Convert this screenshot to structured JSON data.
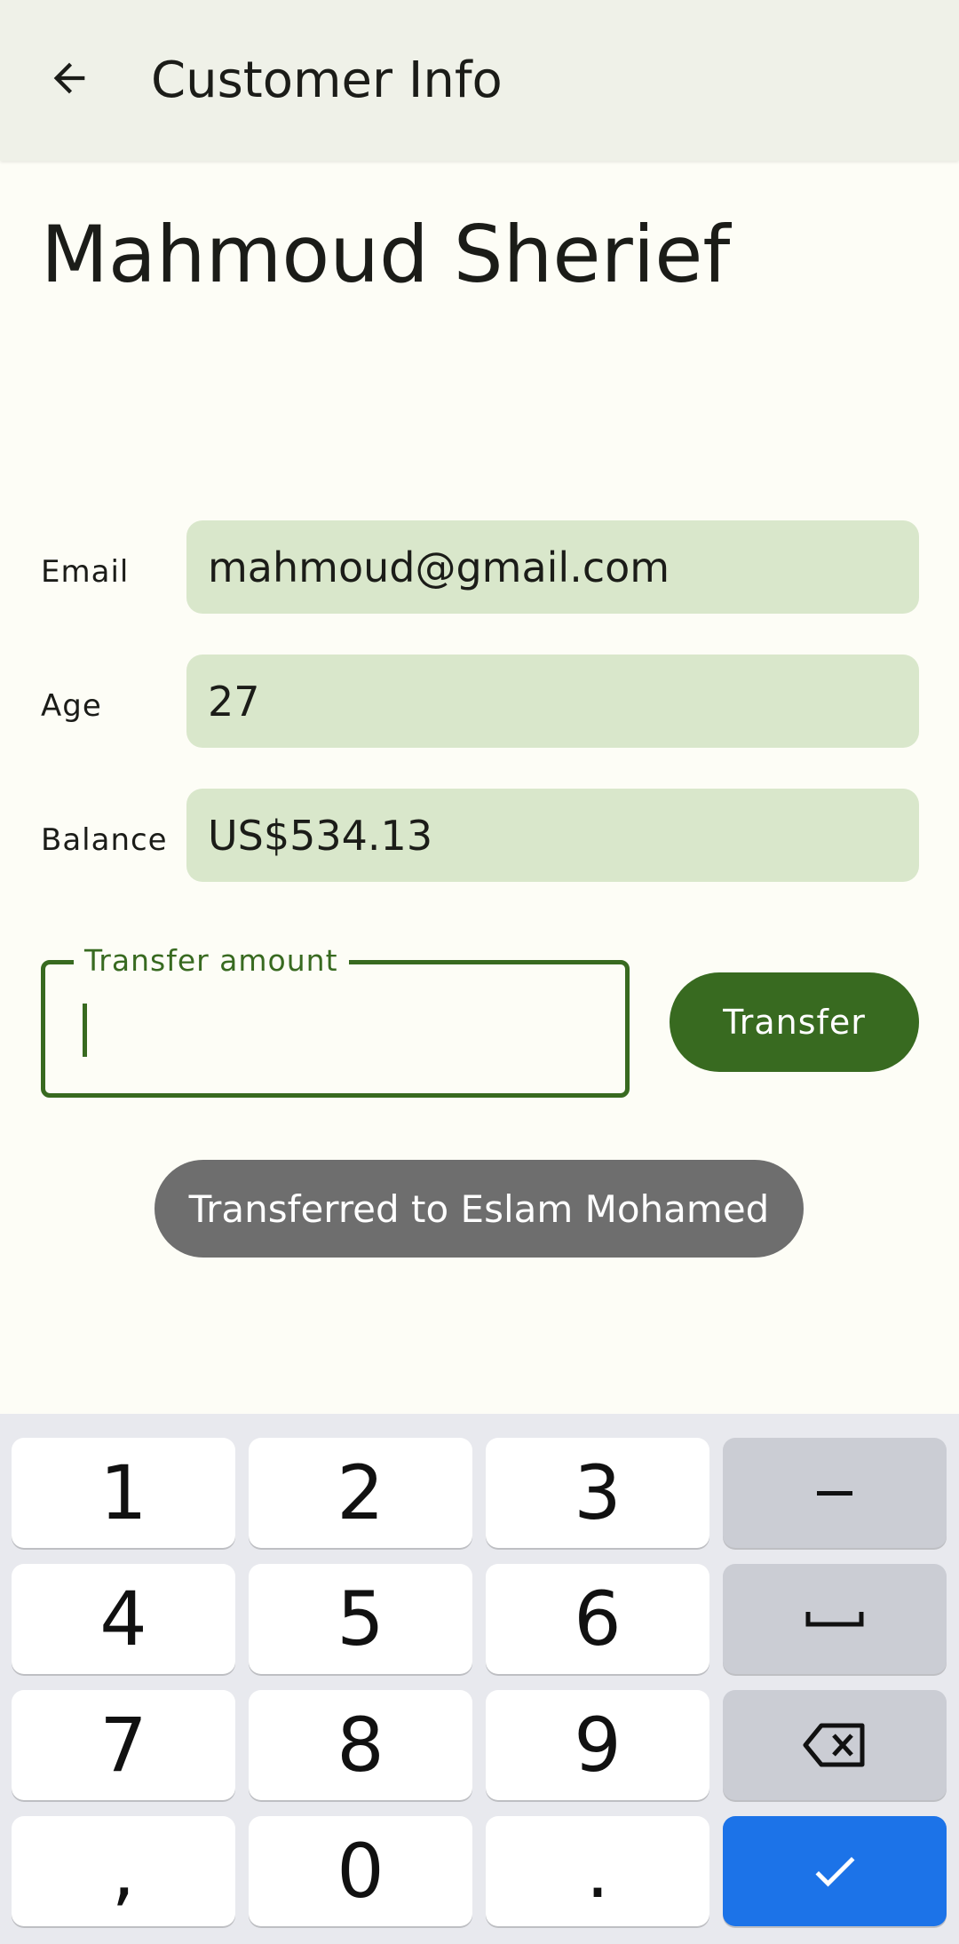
{
  "appbar": {
    "title": "Customer Info",
    "back_icon": "arrow-back-icon"
  },
  "customer": {
    "name": "Mahmoud Sherief"
  },
  "info": {
    "email_label": "Email",
    "email_value": "mahmoud@gmail.com",
    "age_label": "Age",
    "age_value": "27",
    "balance_label": "Balance",
    "balance_value": "US$534.13"
  },
  "transfer": {
    "amount_label": "Transfer amount",
    "amount_value": "",
    "button_label": "Transfer"
  },
  "toast": {
    "message": "Transferred to Eslam Mohamed"
  },
  "keyboard": {
    "keys": [
      "1",
      "2",
      "3",
      "−",
      "4",
      "5",
      "6",
      "␣",
      "7",
      "8",
      "9",
      "⌫",
      ",",
      "0",
      "."
    ],
    "done_icon": "check-icon"
  },
  "colors": {
    "primary": "#386a20",
    "field_bg": "#d9e7cb",
    "appbar_bg": "#eff1e8",
    "toast_bg": "#6e6e6e",
    "keyboard_done": "#1c73e8"
  }
}
